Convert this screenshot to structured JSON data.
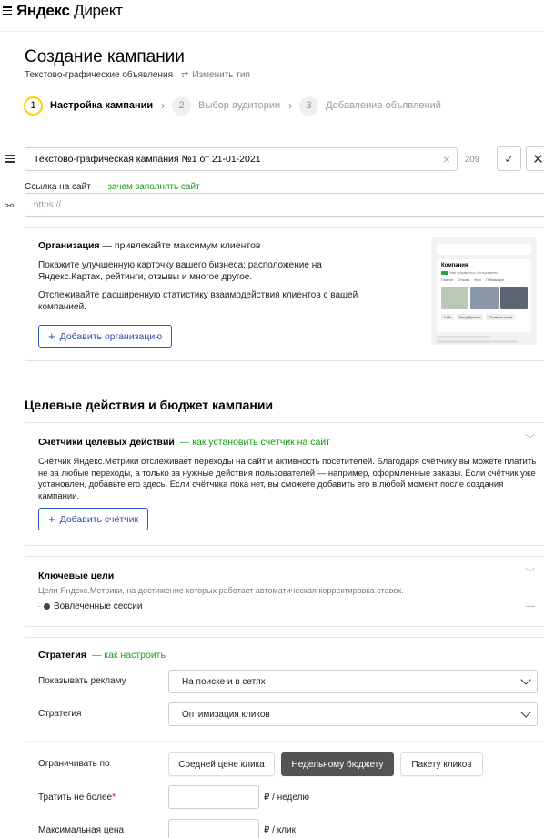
{
  "header": {
    "logo_brand": "Яндекс",
    "logo_product": "Директ"
  },
  "page": {
    "title": "Создание кампании",
    "campaign_type": "Текстово-графические объявления",
    "change_type_label": "Изменить тип"
  },
  "steps": [
    {
      "num": "1",
      "label": "Настройка кампании",
      "state": "active"
    },
    {
      "num": "2",
      "label": "Выбор аудитории",
      "state": "inactive"
    },
    {
      "num": "3",
      "label": "Добавление объявлений",
      "state": "inactive"
    }
  ],
  "campaign_name": {
    "value": "Текстово-графическая кампания №1 от 21-01-2021",
    "chars_left": "209"
  },
  "site": {
    "label": "Ссылка на сайт",
    "hint_link": "— зачем заполнять сайт",
    "placeholder": "https://"
  },
  "organization": {
    "title": "Организация",
    "title_hint": "— привлекайте максимум клиентов",
    "paragraph1": "Покажите улучшенную карточку вашего бизнеса: расположение на Яндекс.Картах, рейтинги, отзывы и многое другое.",
    "paragraph2": "Отслеживайте расширенную статистику взаимодействия клиентов с вашей компанией.",
    "add_button": "Добавить организацию",
    "preview": {
      "company": "Компания",
      "rating_text": "Нам понравилось обслуживание",
      "tabs": [
        "Главное",
        "Отзывы",
        "Фото",
        "Публикации"
      ],
      "buttons": [
        "Сайт",
        "Как добраться",
        "Оставить отзыв"
      ]
    }
  },
  "goals_section": {
    "title": "Целевые действия и бюджет кампании"
  },
  "counters": {
    "title": "Счётчики целевых действий",
    "hint_link": "— как установить счётчик на сайт",
    "text": "Счётчик Яндекс.Метрики отслеживает переходы на сайт и активность посетителей. Благодаря счётчику вы можете платить не за любые переходы, а только за нужные действия пользователей — например, оформленные заказы. Если счётчик уже установлен, добавьте его здесь. Если счётчика пока нет, вы сможете добавить его в любой момент после создания кампании.",
    "add_button": "Добавить счётчик"
  },
  "key_goals": {
    "title": "Ключевые цели",
    "description": "Цели Яндекс.Метрики, на достижение которых работает автоматическая корректировка ставок.",
    "item": "Вовлеченные сессии",
    "item_value": "—"
  },
  "strategy": {
    "title": "Стратегия",
    "hint_link": "— как настроить",
    "show_ads_label": "Показывать рекламу",
    "show_ads_value": "На поиске и в сетях",
    "strategy_label": "Стратегия",
    "strategy_value": "Оптимизация кликов",
    "limit_label": "Ограничивать по",
    "limit_options": [
      "Средней цене клика",
      "Недельному бюджету",
      "Пакету кликов"
    ],
    "limit_selected": "Недельному бюджету",
    "spend_label": "Тратить не более",
    "spend_required": "*",
    "spend_unit": "₽ / неделю",
    "max_price_label": "Максимальная цена",
    "max_price_unit": "₽ / клик"
  },
  "colors": {
    "link_green": "#189a18",
    "button_blue": "#2e5bcc",
    "step_accent": "#ffd000",
    "selected_segment": "#545454"
  }
}
